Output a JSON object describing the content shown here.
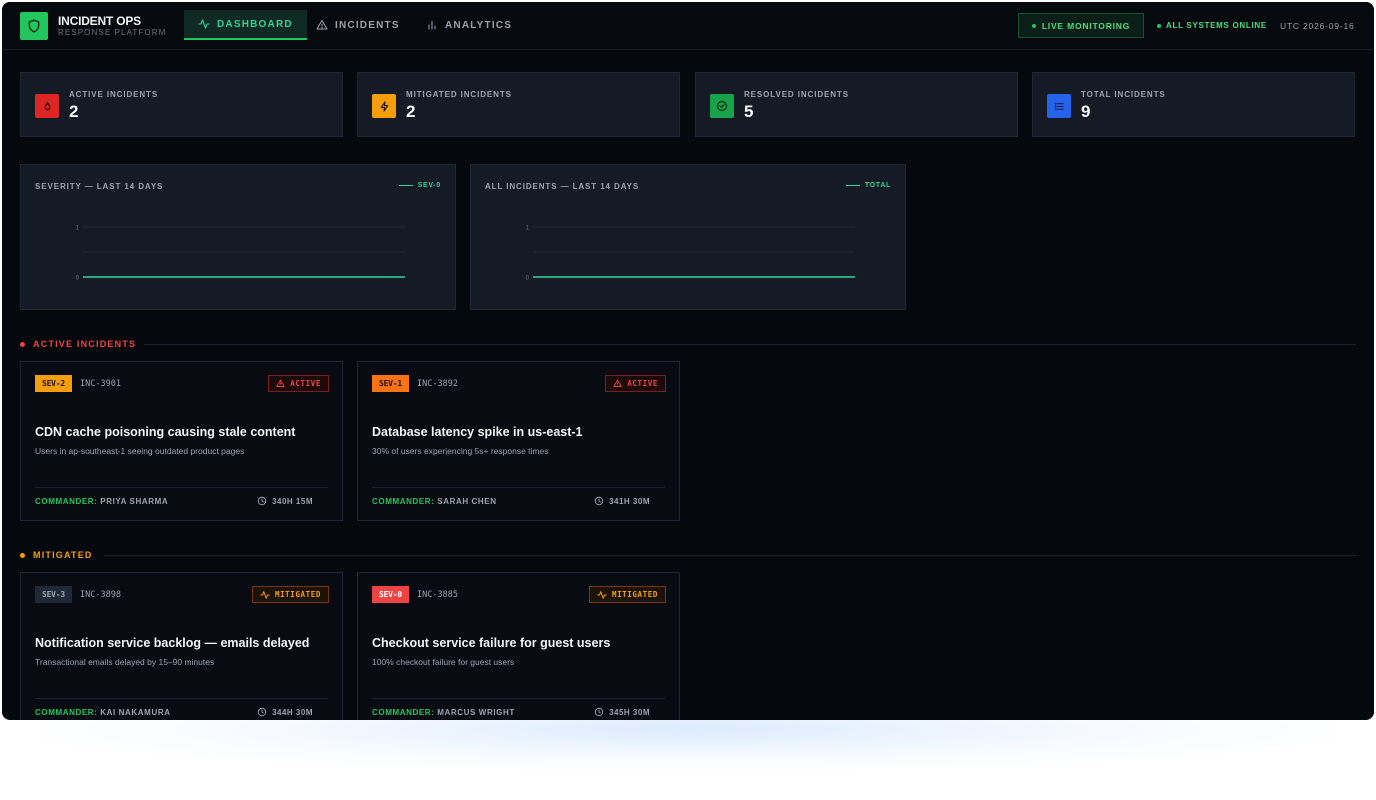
{
  "brand": {
    "title": "INCIDENT OPS",
    "subtitle": "RESPONSE PLATFORM"
  },
  "nav": [
    {
      "label": "DASHBOARD",
      "icon": "activity-icon",
      "active": true
    },
    {
      "label": "INCIDENTS",
      "icon": "warning-icon",
      "active": false
    },
    {
      "label": "ANALYTICS",
      "icon": "bar-chart-icon",
      "active": false
    }
  ],
  "header": {
    "live_label": "LIVE MONITORING",
    "status_label": "ALL SYSTEMS ONLINE",
    "utc_label": "UTC 2026-09-16"
  },
  "stats": [
    {
      "label": "ACTIVE INCIDENTS",
      "value": "2",
      "icon": "flame-icon",
      "color": "#dc2626"
    },
    {
      "label": "MITIGATED INCIDENTS",
      "value": "2",
      "icon": "bolt-icon",
      "color": "#f59e0b"
    },
    {
      "label": "RESOLVED INCIDENTS",
      "value": "5",
      "icon": "check-circle-icon",
      "color": "#16a34a"
    },
    {
      "label": "TOTAL INCIDENTS",
      "value": "9",
      "icon": "list-icon",
      "color": "#2563eb"
    }
  ],
  "chart_data": [
    {
      "type": "line",
      "title": "SEVERITY — LAST 14 DAYS",
      "series": [
        {
          "name": "SEV-0",
          "values": [
            0,
            0,
            0,
            0,
            0,
            0,
            0,
            0,
            0,
            0,
            0,
            0,
            0,
            0
          ]
        }
      ],
      "yticks": [
        "1",
        "0"
      ],
      "ylim": [
        0,
        1
      ],
      "color": "#34d399",
      "legend": "top-right"
    },
    {
      "type": "line",
      "title": "ALL INCIDENTS — LAST 14 DAYS",
      "series": [
        {
          "name": "TOTAL",
          "values": [
            0,
            0,
            0,
            0,
            0,
            0,
            0,
            0,
            0,
            0,
            0,
            0,
            0,
            0
          ]
        }
      ],
      "yticks": [
        "1",
        "0"
      ],
      "ylim": [
        0,
        1
      ],
      "color": "#34d399",
      "legend": "top-right"
    }
  ],
  "sections": {
    "active": {
      "label": "ACTIVE INCIDENTS",
      "color": "#ef4444"
    },
    "mitigated": {
      "label": "MITIGATED",
      "color": "#f59e0b"
    }
  },
  "active_incidents": [
    {
      "sev": "SEV-2",
      "sev_bg": "#f59e0b",
      "sev_fg": "#1f1300",
      "id": "INC-3901",
      "status": "ACTIVE",
      "title": "CDN cache poisoning causing stale content",
      "desc": "Users in ap-southeast-1 seeing outdated product pages",
      "commander_label": "COMMANDER:",
      "commander": "PRIYA SHARMA",
      "duration": "340H 15M"
    },
    {
      "sev": "SEV-1",
      "sev_bg": "#f97316",
      "sev_fg": "#1f0d00",
      "id": "INC-3892",
      "status": "ACTIVE",
      "title": "Database latency spike in us-east-1",
      "desc": "30% of users experiencing 5s+ response times",
      "commander_label": "COMMANDER:",
      "commander": "SARAH CHEN",
      "duration": "341H 30M"
    }
  ],
  "mitigated_incidents": [
    {
      "sev": "SEV-3",
      "sev_bg": "#1f2937",
      "sev_fg": "#9ca3af",
      "id": "INC-3898",
      "status": "MITIGATED",
      "title": "Notification service backlog — emails delayed",
      "desc": "Transactional emails delayed by 15–90 minutes",
      "commander_label": "COMMANDER:",
      "commander": "KAI NAKAMURA",
      "duration": "344H 30M"
    },
    {
      "sev": "SEV-0",
      "sev_bg": "#ef4444",
      "sev_fg": "#ffffff",
      "id": "INC-3885",
      "status": "MITIGATED",
      "title": "Checkout service failure for guest users",
      "desc": "100% checkout failure for guest users",
      "commander_label": "COMMANDER:",
      "commander": "MARCUS WRIGHT",
      "duration": "345H 30M"
    }
  ]
}
